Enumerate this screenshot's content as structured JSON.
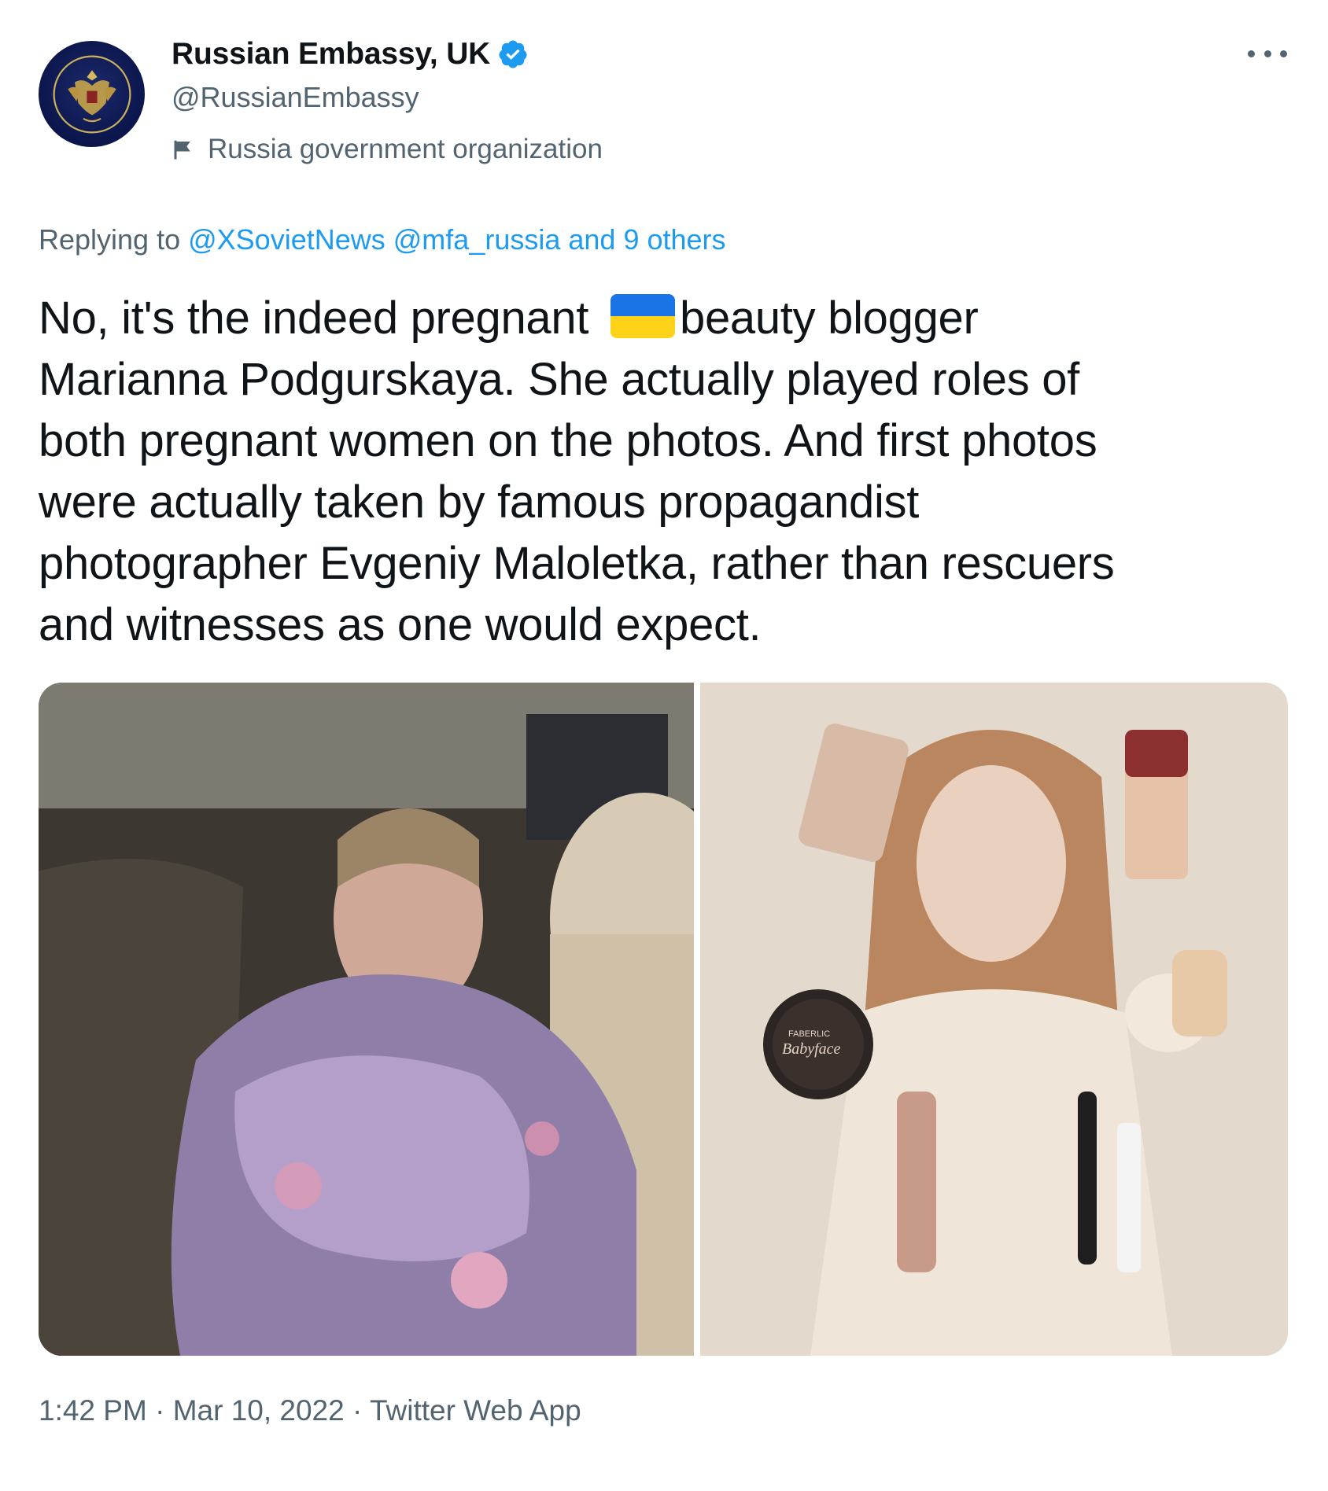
{
  "author": {
    "display_name": "Russian Embassy, UK",
    "handle": "@RussianEmbassy",
    "label": "Russia government organization",
    "verified": true,
    "avatar_icon": "coat-of-arms-icon"
  },
  "reply": {
    "prefix": "Replying to ",
    "mention1": "@XSovietNews",
    "mention2": "@mfa_russia",
    "suffix": "and 9 others"
  },
  "tweet": {
    "lines": [
      {
        "before_flag": "No, it's the indeed pregnant ",
        "after_flag": "beauty blogger"
      },
      "Marianna Podgurskaya. She actually played roles of",
      "both pregnant women on the photos. And first photos",
      "were actually taken by famous propagandist",
      "photographer Evgeniy Maloletka, rather than rescuers",
      "and witnesses as one would expect."
    ],
    "flag_emoji": "ukraine-flag-icon"
  },
  "media": {
    "photo_left": "photo",
    "photo_right": "photo",
    "product_text_1": "FABERLIC",
    "product_text_2": "Babyface",
    "product_text_3": "FAB ER LIC"
  },
  "meta": {
    "time": "1:42 PM",
    "date": "Mar 10, 2022",
    "source": "Twitter Web App",
    "separator": " · "
  },
  "colors": {
    "text": "#0f1419",
    "secondary": "#536471",
    "link": "#1d9bf0",
    "verified": "#1d9bf0",
    "flag_blue": "#1a74e5",
    "flag_yellow": "#ffd21a"
  }
}
